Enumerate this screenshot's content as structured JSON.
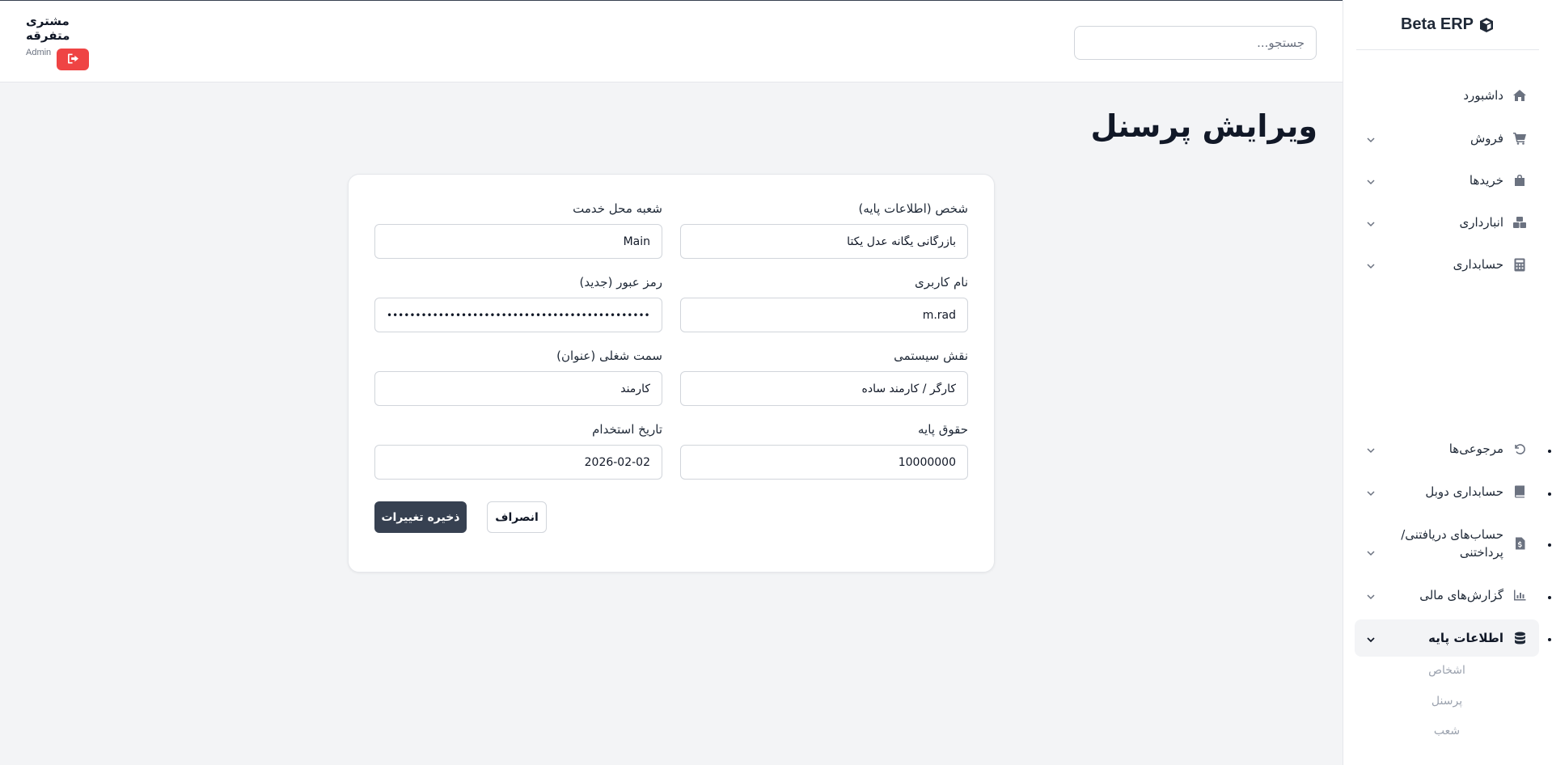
{
  "app": {
    "brand": "Beta ERP"
  },
  "header": {
    "search_placeholder": "جستجو...",
    "user_name": "مشتری متفرقه",
    "user_role": "Admin"
  },
  "sidebar": {
    "items": [
      {
        "label": "داشبورد",
        "icon": "home-icon"
      },
      {
        "label": "فروش",
        "icon": "cart-icon"
      },
      {
        "label": "خریدها",
        "icon": "bag-icon"
      },
      {
        "label": "انبارداری",
        "icon": "boxes-icon"
      },
      {
        "label": "حسابداری",
        "icon": "calculator-icon"
      },
      {
        "label": "مرجوعی‌ها",
        "icon": "undo-icon"
      },
      {
        "label": "حسابداری دوبل",
        "icon": "book-icon"
      },
      {
        "label": "حساب‌های دریافتنی/ پرداختنی",
        "icon": "invoice-icon"
      },
      {
        "label": "گزارش‌های مالی",
        "icon": "chart-icon"
      },
      {
        "label": "اطلاعات پایه",
        "icon": "database-icon"
      }
    ],
    "sub_items": [
      {
        "label": "اشخاص"
      },
      {
        "label": "پرسنل"
      },
      {
        "label": "شعب"
      }
    ]
  },
  "page": {
    "title": "ویرایش پرسنل"
  },
  "form": {
    "person": {
      "label": "شخص (اطلاعات پایه)",
      "value": "بازرگانی یگانه عدل یکتا"
    },
    "branch": {
      "label": "شعبه محل خدمت",
      "value": "Main"
    },
    "username": {
      "label": "نام کاربری",
      "value": "m.rad"
    },
    "password": {
      "label": "رمز عبور (جدید)",
      "value": "••••••••••••••••••••••••••••••••••••••••••••••••••••••••"
    },
    "role": {
      "label": "نقش سیستمی",
      "value": "کارگر / کارمند ساده"
    },
    "position": {
      "label": "سمت شغلی (عنوان)",
      "value": "کارمند"
    },
    "salary": {
      "label": "حقوق پایه",
      "value": "10000000"
    },
    "hire_date": {
      "label": "تاریخ استخدام",
      "value": "2026-02-02"
    },
    "save_label": "ذخیره تغییرات",
    "cancel_label": "انصراف"
  },
  "colors": {
    "primary_button": "#374151",
    "logout_button": "#ef4444",
    "page_background": "#f3f4f6"
  }
}
